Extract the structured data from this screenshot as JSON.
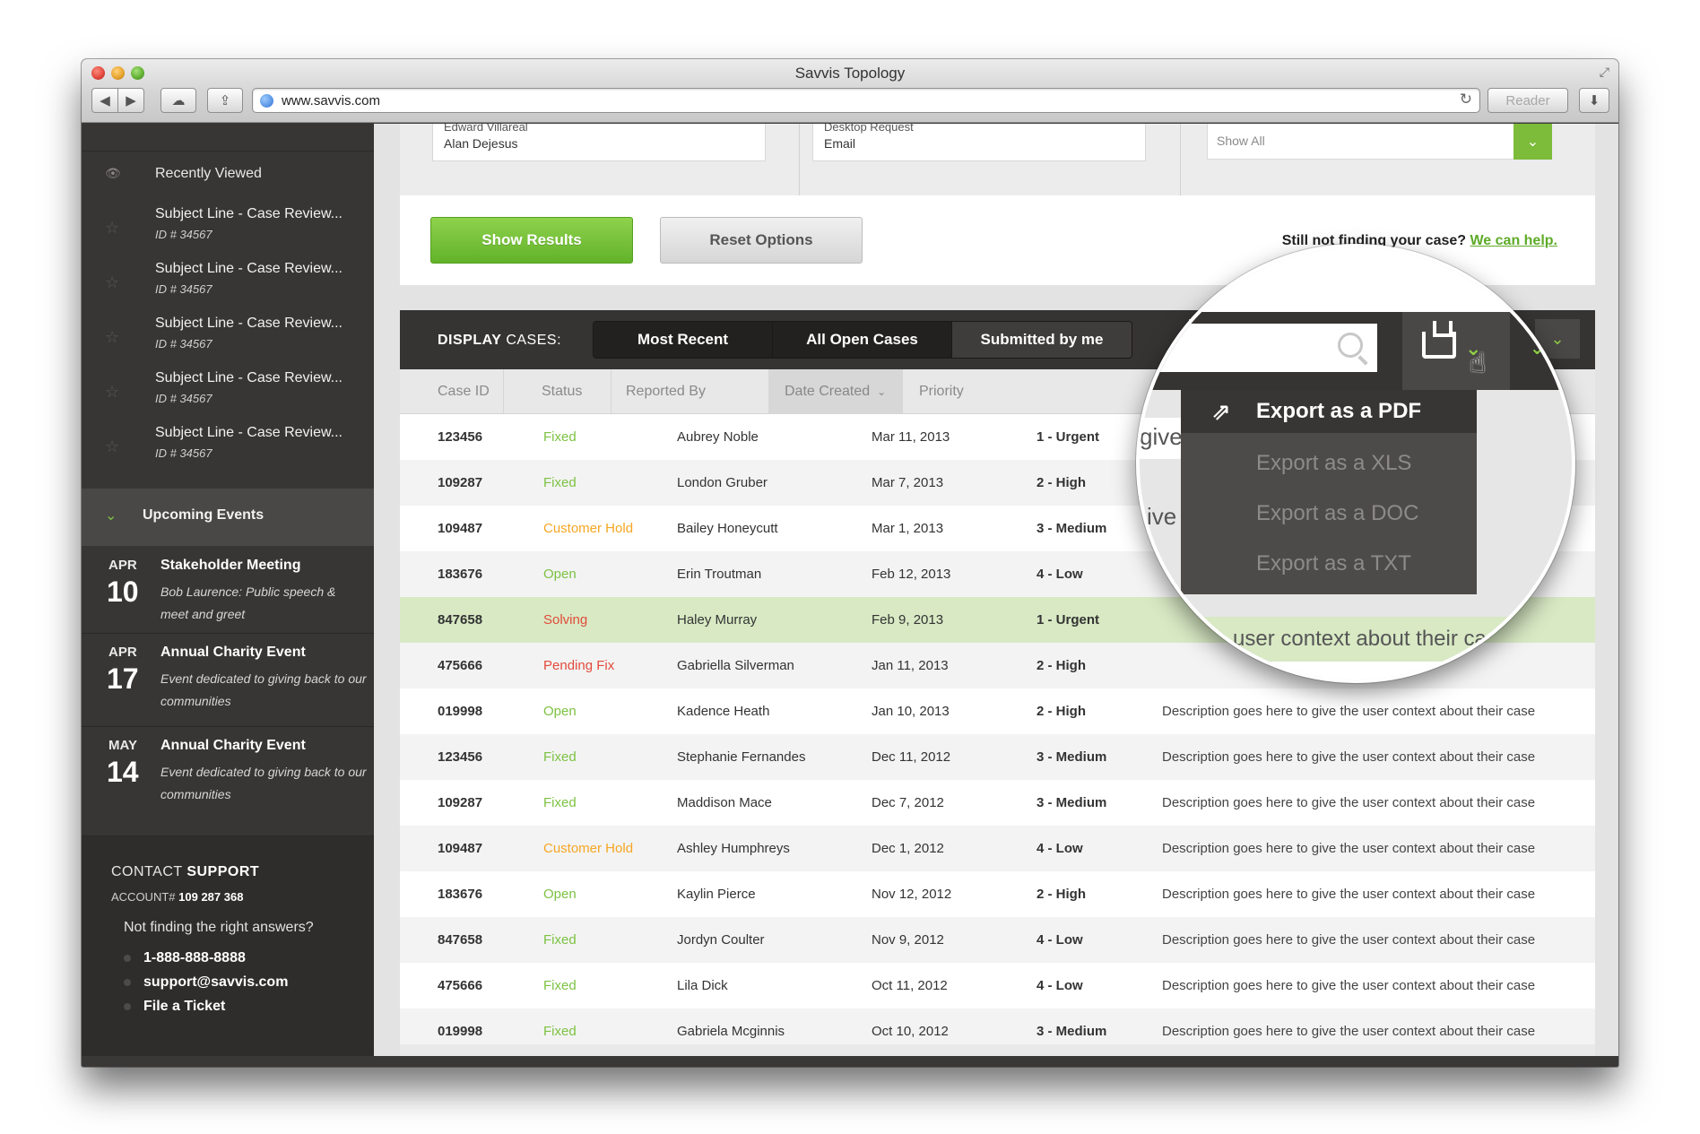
{
  "browser": {
    "window_title": "Savvis Topology",
    "url": "www.savvis.com",
    "reader_label": "Reader",
    "back_icon": "back-arrow-icon",
    "forward_icon": "forward-arrow-icon",
    "cloud_icon": "cloud-icon",
    "share_icon": "share-icon",
    "reload_icon": "reload-icon",
    "download_icon": "download-icon"
  },
  "sidebar": {
    "recent_label": "Recently Viewed",
    "recent_items": [
      {
        "title": "Subject Line - Case Review...",
        "id": "ID # 34567"
      },
      {
        "title": "Subject Line - Case Review...",
        "id": "ID # 34567"
      },
      {
        "title": "Subject Line - Case Review...",
        "id": "ID # 34567"
      },
      {
        "title": "Subject Line - Case Review...",
        "id": "ID # 34567"
      },
      {
        "title": "Subject Line - Case Review...",
        "id": "ID # 34567"
      }
    ],
    "events_label": "Upcoming Events",
    "events": [
      {
        "month": "APR",
        "day": "10",
        "title": "Stakeholder Meeting",
        "desc": "Bob Laurence: Public speech & meet and greet"
      },
      {
        "month": "APR",
        "day": "17",
        "title": "Annual Charity Event",
        "desc": "Event dedicated to giving back to our communities"
      },
      {
        "month": "MAY",
        "day": "14",
        "title": "Annual Charity Event",
        "desc": "Event dedicated to giving back to our communities"
      }
    ],
    "contact": {
      "heading_a": "CONTACT",
      "heading_b": "SUPPORT",
      "account_label": "ACCOUNT#",
      "account_number": "109 287 368",
      "question": "Not finding the right answers?",
      "phone": "1-888-888-8888",
      "email": "support@savvis.com",
      "ticket": "File a Ticket"
    }
  },
  "filters": {
    "box1_line1": "Edward Villareal",
    "box1_line2": "Alan Dejesus",
    "box2_line1": "Desktop Request",
    "box2_line2": "Email",
    "select_value": "Show All"
  },
  "actions": {
    "show_results": "Show Results",
    "reset_options": "Reset Options",
    "still_text": "Still not finding your case?",
    "help_link": "We can help."
  },
  "cases_bar": {
    "label_a": "DISPLAY",
    "label_b": "CASES:",
    "tabs": [
      "Most Recent",
      "All Open Cases",
      "Submitted by me"
    ]
  },
  "table": {
    "columns": [
      "Case ID",
      "Status",
      "Reported By",
      "Date Created",
      "Priority"
    ],
    "rows": [
      {
        "id": "123456",
        "status": "Fixed",
        "status_kind": "fixed",
        "reporter": "Aubrey Noble",
        "date": "Mar 11, 2013",
        "priority": "1 - Urgent",
        "desc": ""
      },
      {
        "id": "109287",
        "status": "Fixed",
        "status_kind": "fixed",
        "reporter": "London Gruber",
        "date": "Mar 7, 2013",
        "priority": "2 - High",
        "desc": ""
      },
      {
        "id": "109487",
        "status": "Customer Hold",
        "status_kind": "hold",
        "reporter": "Bailey Honeycutt",
        "date": "Mar 1, 2013",
        "priority": "3 - Medium",
        "desc": ""
      },
      {
        "id": "183676",
        "status": "Open",
        "status_kind": "open",
        "reporter": "Erin Troutman",
        "date": "Feb 12, 2013",
        "priority": "4 - Low",
        "desc": ""
      },
      {
        "id": "847658",
        "status": "Solving",
        "status_kind": "solving",
        "reporter": "Haley Murray",
        "date": "Feb 9, 2013",
        "priority": "1 - Urgent",
        "desc": ""
      },
      {
        "id": "475666",
        "status": "Pending Fix",
        "status_kind": "pending",
        "reporter": "Gabriella Silverman",
        "date": "Jan 11, 2013",
        "priority": "2 - High",
        "desc": ""
      },
      {
        "id": "019998",
        "status": "Open",
        "status_kind": "open",
        "reporter": "Kadence Heath",
        "date": "Jan 10, 2013",
        "priority": "2 - High",
        "desc": "Description goes here to give the user context about their case"
      },
      {
        "id": "123456",
        "status": "Fixed",
        "status_kind": "fixed",
        "reporter": "Stephanie Fernandes",
        "date": "Dec 11, 2012",
        "priority": "3 - Medium",
        "desc": "Description goes here to give the user context about their case"
      },
      {
        "id": "109287",
        "status": "Fixed",
        "status_kind": "fixed",
        "reporter": "Maddison Mace",
        "date": "Dec 7, 2012",
        "priority": "3 - Medium",
        "desc": "Description goes here to give the user context about their case"
      },
      {
        "id": "109487",
        "status": "Customer Hold",
        "status_kind": "hold",
        "reporter": "Ashley Humphreys",
        "date": "Dec 1, 2012",
        "priority": "4 - Low",
        "desc": "Description goes here to give the user context about their case"
      },
      {
        "id": "183676",
        "status": "Open",
        "status_kind": "open",
        "reporter": "Kaylin Pierce",
        "date": "Nov 12, 2012",
        "priority": "2 - High",
        "desc": "Description goes here to give the user context about their case"
      },
      {
        "id": "847658",
        "status": "Fixed",
        "status_kind": "fixed",
        "reporter": "Jordyn Coulter",
        "date": "Nov 9, 2012",
        "priority": "4 - Low",
        "desc": "Description goes here to give the user context about their case"
      },
      {
        "id": "475666",
        "status": "Fixed",
        "status_kind": "fixed",
        "reporter": "Lila Dick",
        "date": "Oct 11, 2012",
        "priority": "4 - Low",
        "desc": "Description goes here to give the user context about their case"
      },
      {
        "id": "019998",
        "status": "Fixed",
        "status_kind": "fixed",
        "reporter": "Gabriela Mcginnis",
        "date": "Oct 10, 2012",
        "priority": "3 - Medium",
        "desc": "Description goes here to give the user context about their case"
      }
    ]
  },
  "export_menu": {
    "items": [
      "Export as a PDF",
      "Export as a XLS",
      "Export as a DOC",
      "Export as a TXT"
    ],
    "active_index": 0,
    "row_fragment_a": "give",
    "row_fragment_b": "ive",
    "hl_row_text": "Descrie user context about their case"
  },
  "colors": {
    "accent_green": "#7cbc3a",
    "status_hold": "#f5a623",
    "status_red": "#e14b3b",
    "sidebar_bg": "#383634"
  }
}
